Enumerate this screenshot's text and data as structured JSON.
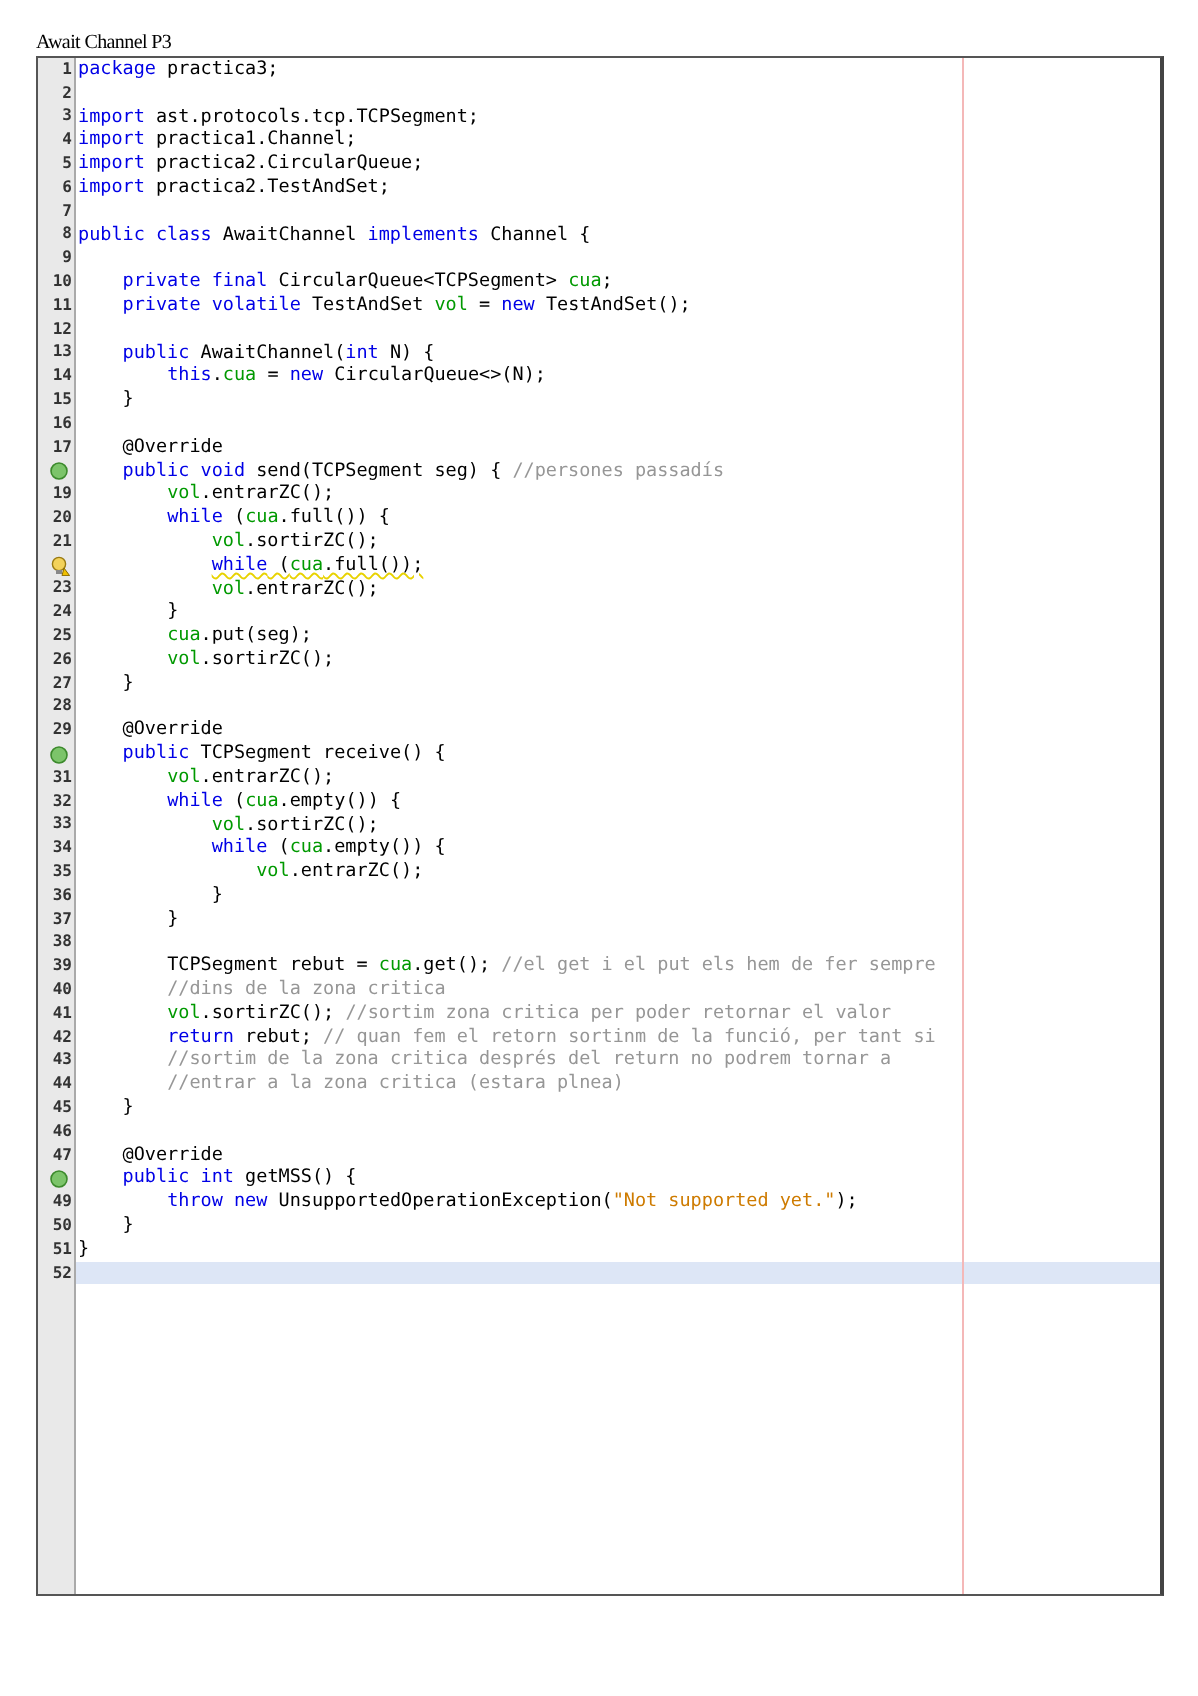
{
  "document": {
    "title": "Await Channel P3"
  },
  "editor": {
    "lines": [
      {
        "kind": "numbered",
        "number": "1",
        "highlighted": false,
        "segments": [
          {
            "kind": "keyword",
            "text": "package"
          },
          {
            "kind": "plain",
            "text": " practica3;"
          }
        ]
      },
      {
        "kind": "numbered",
        "number": "2",
        "highlighted": false
      },
      {
        "kind": "numbered",
        "number": "3",
        "highlighted": false,
        "segments": [
          {
            "kind": "keyword",
            "text": "import"
          },
          {
            "kind": "plain",
            "text": " ast.protocols.tcp.TCPSegment;"
          }
        ]
      },
      {
        "kind": "numbered",
        "number": "4",
        "highlighted": false,
        "segments": [
          {
            "kind": "keyword",
            "text": "import"
          },
          {
            "kind": "plain",
            "text": " practica1.Channel;"
          }
        ]
      },
      {
        "kind": "numbered",
        "number": "5",
        "highlighted": false,
        "segments": [
          {
            "kind": "keyword",
            "text": "import"
          },
          {
            "kind": "plain",
            "text": " practica2.CircularQueue;"
          }
        ]
      },
      {
        "kind": "numbered",
        "number": "6",
        "highlighted": false,
        "segments": [
          {
            "kind": "keyword",
            "text": "import"
          },
          {
            "kind": "plain",
            "text": " practica2.TestAndSet;"
          }
        ]
      },
      {
        "kind": "numbered",
        "number": "7",
        "highlighted": false
      },
      {
        "kind": "numbered",
        "number": "8",
        "highlighted": false,
        "segments": [
          {
            "kind": "keyword",
            "text": "public class"
          },
          {
            "kind": "plain",
            "text": " AwaitChannel "
          },
          {
            "kind": "keyword",
            "text": "implements"
          },
          {
            "kind": "plain",
            "text": " Channel {"
          }
        ]
      },
      {
        "kind": "numbered",
        "number": "9",
        "highlighted": false
      },
      {
        "kind": "numbered",
        "number": "10",
        "highlighted": false,
        "segments": [
          {
            "kind": "keyword",
            "text": "    private final"
          },
          {
            "kind": "plain",
            "text": " CircularQueue<TCPSegment> "
          },
          {
            "kind": "field",
            "text": "cua"
          },
          {
            "kind": "plain",
            "text": ";"
          }
        ]
      },
      {
        "kind": "numbered",
        "number": "11",
        "highlighted": false,
        "segments": [
          {
            "kind": "keyword",
            "text": "    private volatile"
          },
          {
            "kind": "plain",
            "text": " TestAndSet "
          },
          {
            "kind": "field",
            "text": "vol"
          },
          {
            "kind": "plain",
            "text": " = "
          },
          {
            "kind": "keyword",
            "text": "new"
          },
          {
            "kind": "plain",
            "text": " TestAndSet();"
          }
        ]
      },
      {
        "kind": "numbered",
        "number": "12",
        "highlighted": false
      },
      {
        "kind": "numbered",
        "number": "13",
        "highlighted": false,
        "segments": [
          {
            "kind": "keyword",
            "text": "    public"
          },
          {
            "kind": "plain",
            "text": " AwaitChannel("
          },
          {
            "kind": "keyword",
            "text": "int"
          },
          {
            "kind": "plain",
            "text": " N) {"
          }
        ]
      },
      {
        "kind": "numbered",
        "number": "14",
        "highlighted": false,
        "segments": [
          {
            "kind": "keyword",
            "text": "        this"
          },
          {
            "kind": "plain",
            "text": "."
          },
          {
            "kind": "field",
            "text": "cua"
          },
          {
            "kind": "plain",
            "text": " = "
          },
          {
            "kind": "keyword",
            "text": "new"
          },
          {
            "kind": "plain",
            "text": " CircularQueue<>(N);"
          }
        ]
      },
      {
        "kind": "numbered",
        "number": "15",
        "highlighted": false,
        "segments": [
          {
            "kind": "plain",
            "text": "    }"
          }
        ]
      },
      {
        "kind": "numbered",
        "number": "16",
        "highlighted": false
      },
      {
        "kind": "numbered",
        "number": "17",
        "highlighted": false,
        "segments": [
          {
            "kind": "plain",
            "text": "    @Override"
          }
        ]
      },
      {
        "kind": "override",
        "highlighted": false,
        "segments": [
          {
            "kind": "keyword",
            "text": "    public void"
          },
          {
            "kind": "plain",
            "text": " send(TCPSegment seg) { "
          },
          {
            "kind": "comment",
            "text": "//persones passadís"
          }
        ]
      },
      {
        "kind": "numbered",
        "number": "19",
        "highlighted": false,
        "segments": [
          {
            "kind": "field",
            "text": "        vol"
          },
          {
            "kind": "plain",
            "text": ".entrarZC();"
          }
        ]
      },
      {
        "kind": "numbered",
        "number": "20",
        "highlighted": false,
        "segments": [
          {
            "kind": "keyword",
            "text": "        while"
          },
          {
            "kind": "plain",
            "text": " ("
          },
          {
            "kind": "field",
            "text": "cua"
          },
          {
            "kind": "plain",
            "text": ".full()) {"
          }
        ]
      },
      {
        "kind": "numbered",
        "number": "21",
        "highlighted": false,
        "segments": [
          {
            "kind": "field",
            "text": "            vol"
          },
          {
            "kind": "plain",
            "text": ".sortirZC();"
          }
        ]
      },
      {
        "kind": "warning",
        "highlighted": false,
        "segments": [
          {
            "kind": "keyword",
            "text": "            while"
          },
          {
            "kind": "plain",
            "text": " ("
          },
          {
            "kind": "field",
            "text": "cua"
          },
          {
            "kind": "plain",
            "text": ".full());"
          }
        ]
      },
      {
        "kind": "numbered",
        "number": "23",
        "highlighted": false,
        "segments": [
          {
            "kind": "field",
            "text": "            vol"
          },
          {
            "kind": "plain",
            "text": ".entrarZC();"
          }
        ]
      },
      {
        "kind": "numbered",
        "number": "24",
        "highlighted": false,
        "segments": [
          {
            "kind": "plain",
            "text": "        }"
          }
        ]
      },
      {
        "kind": "numbered",
        "number": "25",
        "highlighted": false,
        "segments": [
          {
            "kind": "field",
            "text": "        cua"
          },
          {
            "kind": "plain",
            "text": ".put(seg);"
          }
        ]
      },
      {
        "kind": "numbered",
        "number": "26",
        "highlighted": false,
        "segments": [
          {
            "kind": "field",
            "text": "        vol"
          },
          {
            "kind": "plain",
            "text": ".sortirZC();"
          }
        ]
      },
      {
        "kind": "numbered",
        "number": "27",
        "highlighted": false,
        "segments": [
          {
            "kind": "plain",
            "text": "    }"
          }
        ]
      },
      {
        "kind": "numbered",
        "number": "28",
        "highlighted": false
      },
      {
        "kind": "numbered",
        "number": "29",
        "highlighted": false,
        "segments": [
          {
            "kind": "plain",
            "text": "    @Override"
          }
        ]
      },
      {
        "kind": "override",
        "highlighted": false,
        "segments": [
          {
            "kind": "keyword",
            "text": "    public"
          },
          {
            "kind": "plain",
            "text": " TCPSegment receive() {"
          }
        ]
      },
      {
        "kind": "numbered",
        "number": "31",
        "highlighted": false,
        "segments": [
          {
            "kind": "field",
            "text": "        vol"
          },
          {
            "kind": "plain",
            "text": ".entrarZC();"
          }
        ]
      },
      {
        "kind": "numbered",
        "number": "32",
        "highlighted": false,
        "segments": [
          {
            "kind": "keyword",
            "text": "        while"
          },
          {
            "kind": "plain",
            "text": " ("
          },
          {
            "kind": "field",
            "text": "cua"
          },
          {
            "kind": "plain",
            "text": ".empty()) {"
          }
        ]
      },
      {
        "kind": "numbered",
        "number": "33",
        "highlighted": false,
        "segments": [
          {
            "kind": "field",
            "text": "            vol"
          },
          {
            "kind": "plain",
            "text": ".sortirZC();"
          }
        ]
      },
      {
        "kind": "numbered",
        "number": "34",
        "highlighted": false,
        "segments": [
          {
            "kind": "keyword",
            "text": "            while"
          },
          {
            "kind": "plain",
            "text": " ("
          },
          {
            "kind": "field",
            "text": "cua"
          },
          {
            "kind": "plain",
            "text": ".empty()) {"
          }
        ]
      },
      {
        "kind": "numbered",
        "number": "35",
        "highlighted": false,
        "segments": [
          {
            "kind": "field",
            "text": "                vol"
          },
          {
            "kind": "plain",
            "text": ".entrarZC();"
          }
        ]
      },
      {
        "kind": "numbered",
        "number": "36",
        "highlighted": false,
        "segments": [
          {
            "kind": "plain",
            "text": "            }"
          }
        ]
      },
      {
        "kind": "numbered",
        "number": "37",
        "highlighted": false,
        "segments": [
          {
            "kind": "plain",
            "text": "        }"
          }
        ]
      },
      {
        "kind": "numbered",
        "number": "38",
        "highlighted": false
      },
      {
        "kind": "numbered",
        "number": "39",
        "highlighted": false,
        "segments": [
          {
            "kind": "plain",
            "text": "        TCPSegment rebut = "
          },
          {
            "kind": "field",
            "text": "cua"
          },
          {
            "kind": "plain",
            "text": ".get(); "
          },
          {
            "kind": "comment",
            "text": "//el get i el put els hem de fer sempre"
          }
        ]
      },
      {
        "kind": "numbered",
        "number": "40",
        "highlighted": false,
        "segments": [
          {
            "kind": "comment",
            "text": "        //dins de la zona critica"
          }
        ]
      },
      {
        "kind": "numbered",
        "number": "41",
        "highlighted": false,
        "segments": [
          {
            "kind": "field",
            "text": "        vol"
          },
          {
            "kind": "plain",
            "text": ".sortirZC(); "
          },
          {
            "kind": "comment",
            "text": "//sortim zona critica per poder retornar el valor"
          }
        ]
      },
      {
        "kind": "numbered",
        "number": "42",
        "highlighted": false,
        "segments": [
          {
            "kind": "keyword",
            "text": "        return"
          },
          {
            "kind": "plain",
            "text": " rebut; "
          },
          {
            "kind": "comment",
            "text": "// quan fem el retorn sortinm de la funció, per tant si"
          }
        ]
      },
      {
        "kind": "numbered",
        "number": "43",
        "highlighted": false,
        "segments": [
          {
            "kind": "comment",
            "text": "        //sortim de la zona critica després del return no podrem tornar a"
          }
        ]
      },
      {
        "kind": "numbered",
        "number": "44",
        "highlighted": false,
        "segments": [
          {
            "kind": "comment",
            "text": "        //entrar a la zona critica (estara plnea)"
          }
        ]
      },
      {
        "kind": "numbered",
        "number": "45",
        "highlighted": false,
        "segments": [
          {
            "kind": "plain",
            "text": "    }"
          }
        ]
      },
      {
        "kind": "numbered",
        "number": "46",
        "highlighted": false
      },
      {
        "kind": "numbered",
        "number": "47",
        "highlighted": false,
        "segments": [
          {
            "kind": "plain",
            "text": "    @Override"
          }
        ]
      },
      {
        "kind": "override",
        "highlighted": false,
        "segments": [
          {
            "kind": "keyword",
            "text": "    public int"
          },
          {
            "kind": "plain",
            "text": " getMSS() {"
          }
        ]
      },
      {
        "kind": "numbered",
        "number": "49",
        "highlighted": false,
        "segments": [
          {
            "kind": "keyword",
            "text": "        throw new"
          },
          {
            "kind": "plain",
            "text": " UnsupportedOperationException("
          },
          {
            "kind": "string",
            "text": "\"Not supported yet.\""
          },
          {
            "kind": "plain",
            "text": ");"
          }
        ]
      },
      {
        "kind": "numbered",
        "number": "50",
        "highlighted": false,
        "segments": [
          {
            "kind": "plain",
            "text": "    }"
          }
        ]
      },
      {
        "kind": "numbered",
        "number": "51",
        "highlighted": false,
        "segments": [
          {
            "kind": "plain",
            "text": "}"
          }
        ]
      },
      {
        "kind": "numbered",
        "number": "52",
        "highlighted": true
      }
    ]
  }
}
